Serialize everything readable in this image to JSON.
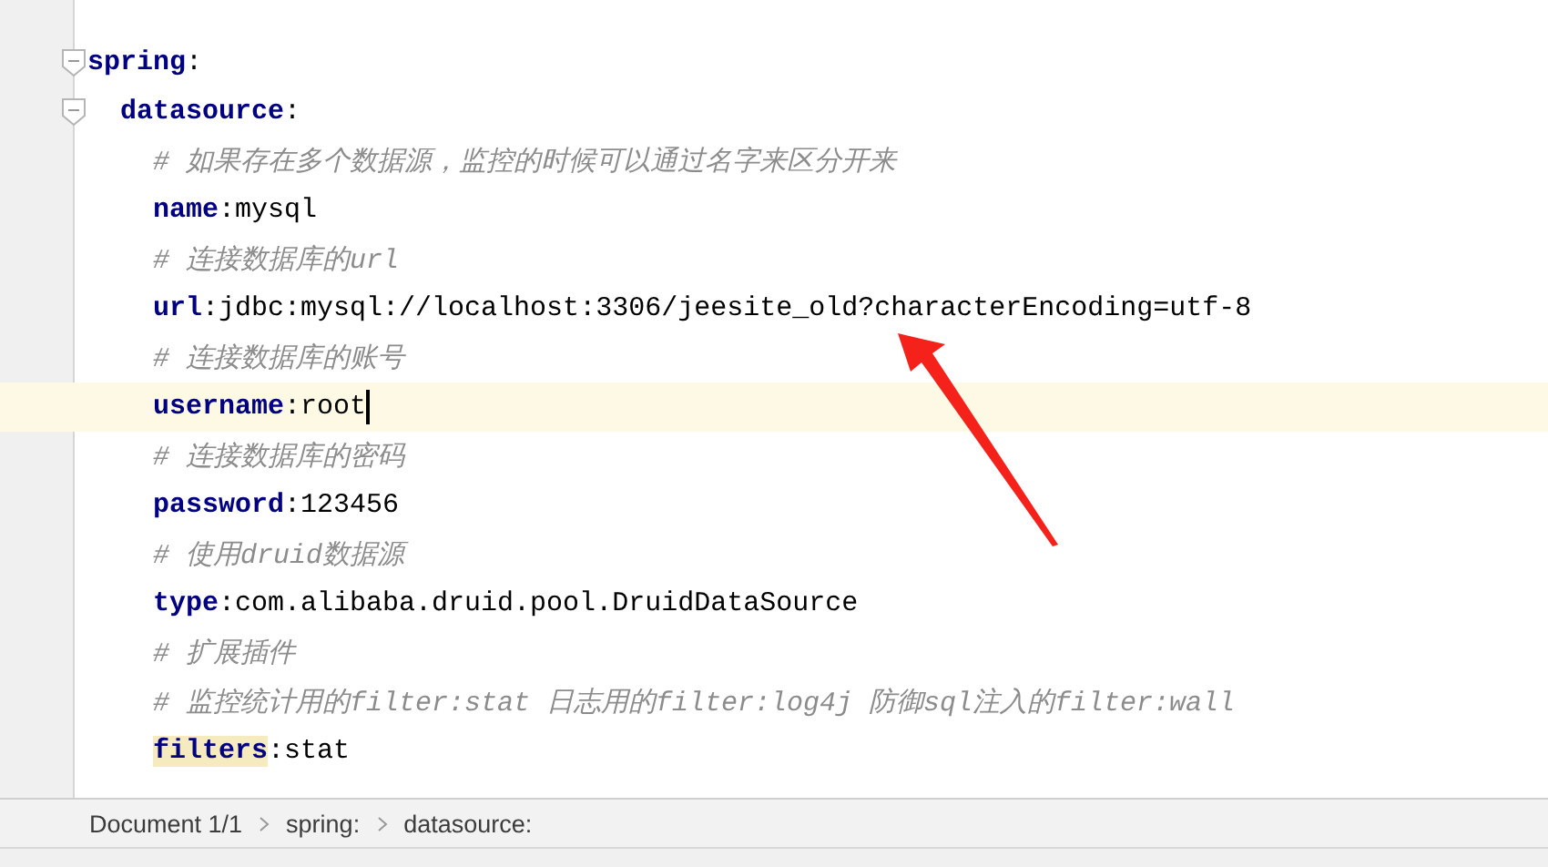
{
  "editor": {
    "lines": [
      {
        "kind": "pair",
        "key": "spring",
        "colon": ":",
        "expanded": true,
        "current": false,
        "key_highlighted": false,
        "children": [
          {
            "kind": "pair",
            "key": "datasource",
            "colon": ":",
            "expanded": true,
            "current": false,
            "key_highlighted": false,
            "children": [
              {
                "kind": "comment",
                "text": "# 如果存在多个数据源，监控的时候可以通过名字来区分开来"
              },
              {
                "kind": "pair",
                "key": "name",
                "colon": ":",
                "value": "mysql",
                "current": false,
                "key_highlighted": false
              },
              {
                "kind": "comment",
                "text": "# 连接数据库的url"
              },
              {
                "kind": "pair",
                "key": "url",
                "colon": ":",
                "value": "jdbc:mysql://localhost:3306/jeesite_old?characterEncoding=utf-8",
                "current": false,
                "key_highlighted": false
              },
              {
                "kind": "comment",
                "text": "# 连接数据库的账号"
              },
              {
                "kind": "pair",
                "key": "username",
                "colon": ":",
                "value": "root",
                "current": true,
                "key_highlighted": false
              },
              {
                "kind": "comment",
                "text": "# 连接数据库的密码"
              },
              {
                "kind": "pair",
                "key": "password",
                "colon": ":",
                "value": "123456",
                "current": false,
                "key_highlighted": false
              },
              {
                "kind": "comment",
                "text": "# 使用druid数据源"
              },
              {
                "kind": "pair",
                "key": "type",
                "colon": ":",
                "value": "com.alibaba.druid.pool.DruidDataSource",
                "current": false,
                "key_highlighted": false
              },
              {
                "kind": "comment",
                "text": "# 扩展插件"
              },
              {
                "kind": "comment",
                "text": "# 监控统计用的filter:stat 日志用的filter:log4j 防御sql注入的filter:wall"
              },
              {
                "kind": "pair",
                "key": "filters",
                "colon": ":",
                "value": "stat",
                "current": false,
                "key_highlighted": true
              }
            ]
          }
        ]
      }
    ]
  },
  "status_bar": {
    "breadcrumbs": [
      "Document 1/1",
      "spring:",
      "datasource:"
    ]
  }
}
